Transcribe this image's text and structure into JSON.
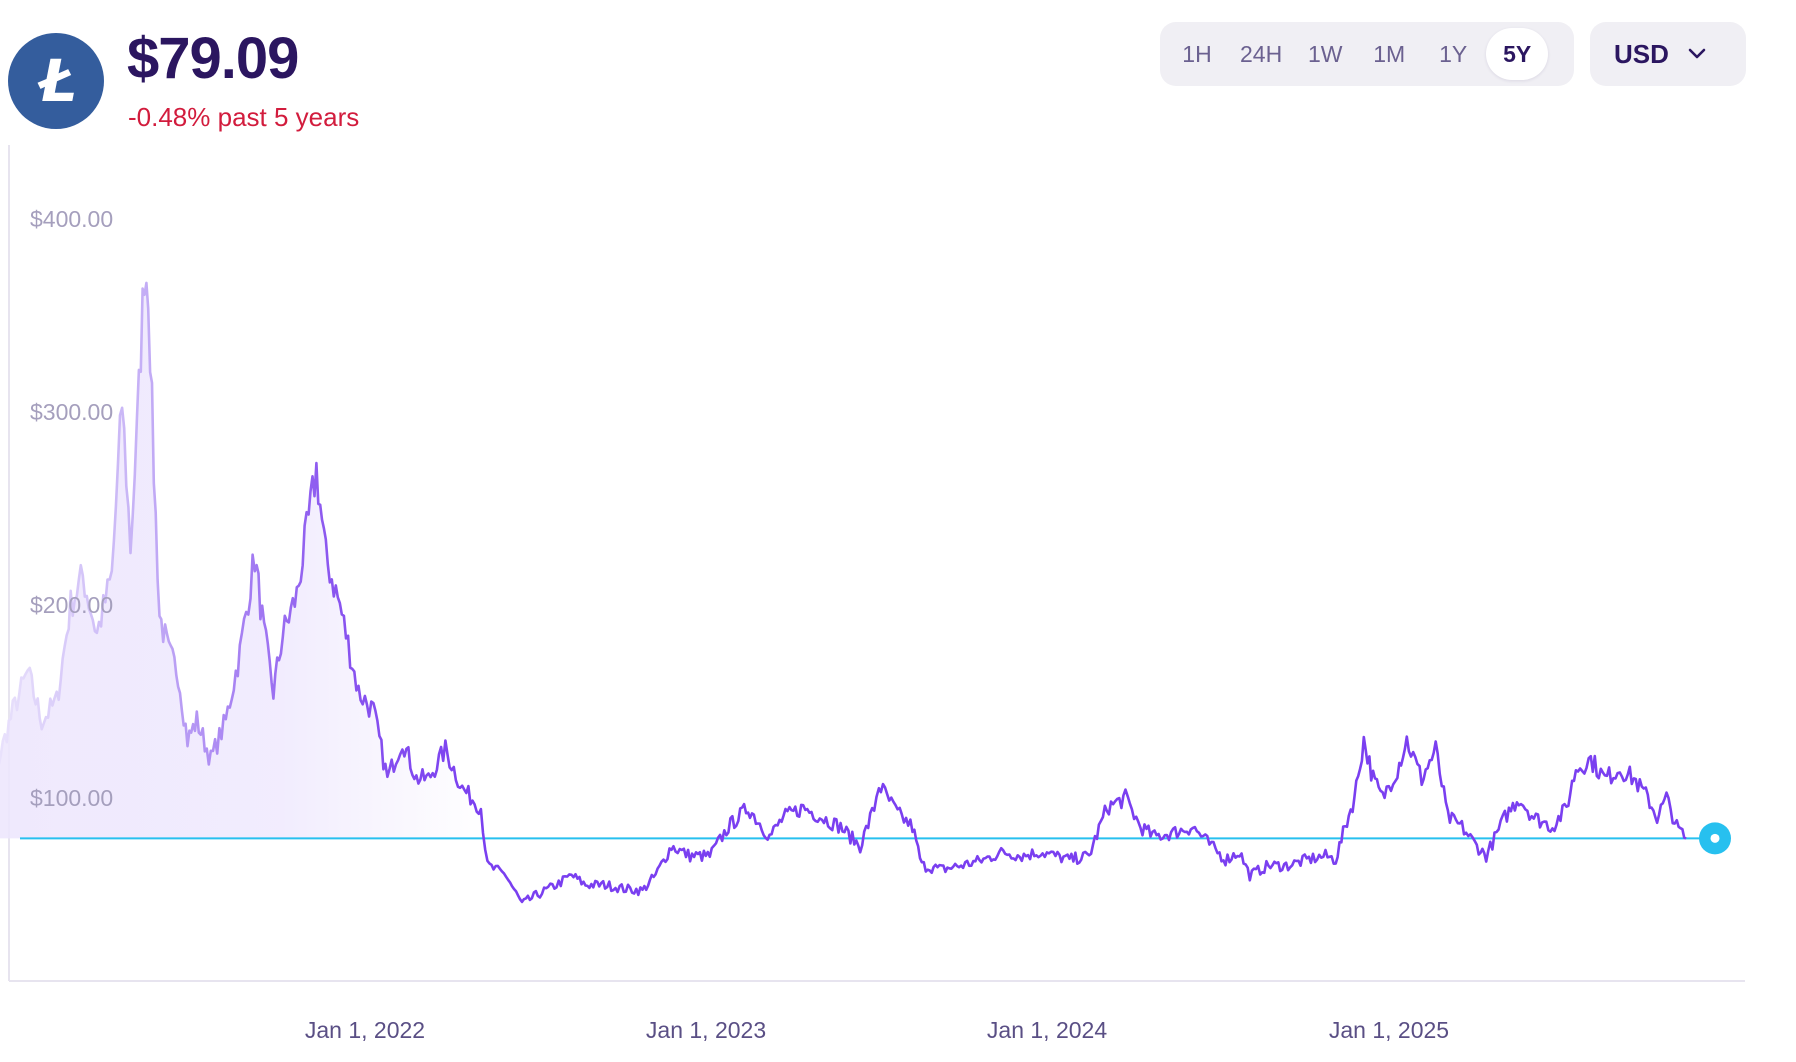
{
  "header": {
    "coin_icon": "litecoin-logo",
    "coin_symbol_glyph": "Ł",
    "price": "$79.09",
    "change_text": "-0.48% past 5 years"
  },
  "range_selector": {
    "options": [
      "1H",
      "24H",
      "1W",
      "1M",
      "1Y",
      "5Y"
    ],
    "selected": "5Y"
  },
  "currency": {
    "selected": "USD"
  },
  "colors": {
    "line_recent": "#7a3ff0",
    "line_faded": "#c9b6f6",
    "area_fill": "#ede6fd",
    "reference_line": "#27c0ef",
    "current_marker": "#27c0ef",
    "negative_change": "#d21c3d"
  },
  "chart_data": {
    "type": "line",
    "y_ticks": [
      "$400.00",
      "$300.00",
      "$200.00",
      "$100.00"
    ],
    "y_tick_values": [
      400,
      300,
      200,
      100
    ],
    "x_ticks": [
      "Jan 1, 2022",
      "Jan 1, 2023",
      "Jan 1, 2024",
      "Jan 1, 2025"
    ],
    "x_tick_dates": [
      "2022-01-01",
      "2023-01-01",
      "2024-01-01",
      "2025-01-01"
    ],
    "ylim": [
      -20,
      420
    ],
    "reference_value": 79.09,
    "series": [
      {
        "points": [
          [
            "2020-11-07",
            80
          ],
          [
            "2020-11-20",
            85
          ],
          [
            "2020-12-05",
            120
          ],
          [
            "2020-12-20",
            145
          ],
          [
            "2021-01-05",
            165
          ],
          [
            "2021-01-20",
            140
          ],
          [
            "2021-02-05",
            150
          ],
          [
            "2021-02-20",
            200
          ],
          [
            "2021-03-05",
            215
          ],
          [
            "2021-03-20",
            185
          ],
          [
            "2021-04-05",
            215
          ],
          [
            "2021-04-16",
            305
          ],
          [
            "2021-04-25",
            230
          ],
          [
            "2021-05-02",
            290
          ],
          [
            "2021-05-10",
            375
          ],
          [
            "2021-05-14",
            365
          ],
          [
            "2021-05-20",
            270
          ],
          [
            "2021-05-26",
            195
          ],
          [
            "2021-06-05",
            175
          ],
          [
            "2021-06-15",
            165
          ],
          [
            "2021-06-25",
            130
          ],
          [
            "2021-07-05",
            140
          ],
          [
            "2021-07-20",
            120
          ],
          [
            "2021-08-05",
            140
          ],
          [
            "2021-08-20",
            175
          ],
          [
            "2021-09-05",
            225
          ],
          [
            "2021-09-15",
            185
          ],
          [
            "2021-09-25",
            155
          ],
          [
            "2021-10-05",
            185
          ],
          [
            "2021-10-20",
            205
          ],
          [
            "2021-11-10",
            270
          ],
          [
            "2021-11-20",
            225
          ],
          [
            "2021-12-05",
            200
          ],
          [
            "2021-12-25",
            155
          ],
          [
            "2022-01-10",
            145
          ],
          [
            "2022-01-25",
            110
          ],
          [
            "2022-02-10",
            130
          ],
          [
            "2022-02-25",
            110
          ],
          [
            "2022-03-10",
            110
          ],
          [
            "2022-03-28",
            125
          ],
          [
            "2022-04-15",
            105
          ],
          [
            "2022-05-05",
            95
          ],
          [
            "2022-05-12",
            65
          ],
          [
            "2022-06-01",
            60
          ],
          [
            "2022-06-18",
            45
          ],
          [
            "2022-07-05",
            50
          ],
          [
            "2022-07-25",
            55
          ],
          [
            "2022-08-10",
            60
          ],
          [
            "2022-08-25",
            55
          ],
          [
            "2022-09-15",
            55
          ],
          [
            "2022-10-05",
            53
          ],
          [
            "2022-10-25",
            52
          ],
          [
            "2022-11-08",
            60
          ],
          [
            "2022-11-25",
            75
          ],
          [
            "2022-12-15",
            70
          ],
          [
            "2023-01-05",
            70
          ],
          [
            "2023-01-25",
            85
          ],
          [
            "2023-02-15",
            95
          ],
          [
            "2023-03-10",
            80
          ],
          [
            "2023-03-25",
            90
          ],
          [
            "2023-04-15",
            95
          ],
          [
            "2023-05-05",
            90
          ],
          [
            "2023-05-25",
            85
          ],
          [
            "2023-06-15",
            75
          ],
          [
            "2023-06-30",
            95
          ],
          [
            "2023-07-05",
            107
          ],
          [
            "2023-07-25",
            92
          ],
          [
            "2023-08-10",
            85
          ],
          [
            "2023-08-20",
            65
          ],
          [
            "2023-09-10",
            63
          ],
          [
            "2023-10-01",
            65
          ],
          [
            "2023-10-25",
            68
          ],
          [
            "2023-11-15",
            72
          ],
          [
            "2023-12-05",
            70
          ],
          [
            "2023-12-25",
            72
          ],
          [
            "2024-01-10",
            70
          ],
          [
            "2024-01-25",
            68
          ],
          [
            "2024-02-15",
            70
          ],
          [
            "2024-03-05",
            95
          ],
          [
            "2024-03-25",
            100
          ],
          [
            "2024-04-10",
            85
          ],
          [
            "2024-04-25",
            80
          ],
          [
            "2024-05-15",
            82
          ],
          [
            "2024-06-05",
            85
          ],
          [
            "2024-06-25",
            75
          ],
          [
            "2024-07-10",
            68
          ],
          [
            "2024-07-25",
            72
          ],
          [
            "2024-08-05",
            60
          ],
          [
            "2024-08-25",
            65
          ],
          [
            "2024-09-15",
            65
          ],
          [
            "2024-10-05",
            68
          ],
          [
            "2024-10-25",
            70
          ],
          [
            "2024-11-05",
            68
          ],
          [
            "2024-11-15",
            85
          ],
          [
            "2024-11-25",
            100
          ],
          [
            "2024-12-05",
            130
          ],
          [
            "2024-12-15",
            110
          ],
          [
            "2024-12-25",
            100
          ],
          [
            "2025-01-10",
            115
          ],
          [
            "2025-01-20",
            130
          ],
          [
            "2025-02-05",
            110
          ],
          [
            "2025-02-20",
            125
          ],
          [
            "2025-03-05",
            90
          ],
          [
            "2025-03-20",
            85
          ],
          [
            "2025-04-05",
            75
          ],
          [
            "2025-04-15",
            70
          ],
          [
            "2025-05-05",
            90
          ],
          [
            "2025-05-20",
            100
          ],
          [
            "2025-06-05",
            90
          ],
          [
            "2025-06-25",
            85
          ],
          [
            "2025-07-10",
            95
          ],
          [
            "2025-07-20",
            115
          ],
          [
            "2025-08-05",
            120
          ],
          [
            "2025-08-20",
            110
          ],
          [
            "2025-09-05",
            115
          ],
          [
            "2025-09-20",
            110
          ],
          [
            "2025-10-05",
            100
          ],
          [
            "2025-10-15",
            90
          ],
          [
            "2025-10-25",
            100
          ],
          [
            "2025-11-05",
            85
          ],
          [
            "2025-11-15",
            79
          ]
        ]
      }
    ]
  }
}
